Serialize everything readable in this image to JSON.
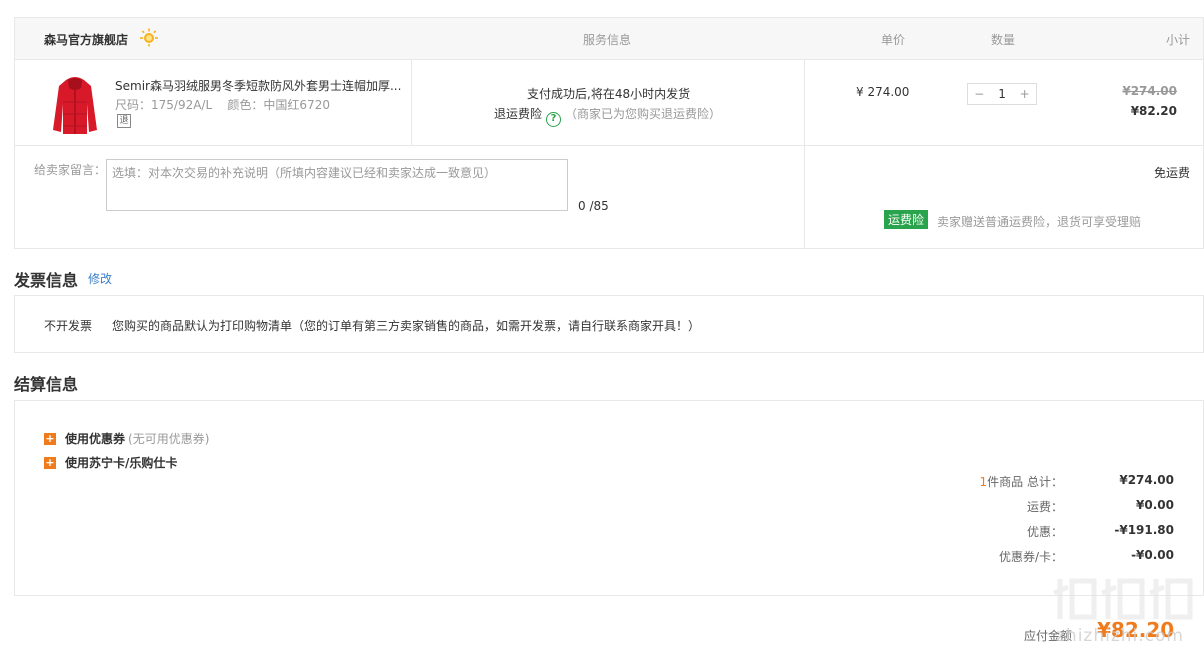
{
  "store": {
    "name": "森马官方旗舰店",
    "badge_icon": "sun-badge-icon"
  },
  "columns": {
    "service": "服务信息",
    "unit_price": "单价",
    "quantity": "数量",
    "subtotal": "小计"
  },
  "item": {
    "title": "Semir森马羽绒服男冬季短款防风外套男士连帽加厚...",
    "size": "尺码：175/92A/L",
    "color": "颜色：中国红6720",
    "refund_tag": "退",
    "shipping": "支付成功后,将在48小时内发货",
    "insurance_label": "退运费险",
    "insurance_note": "（商家已为您购买退运费险）",
    "unit_price": "¥ 274.00",
    "qty": "1",
    "qty_minus": "−",
    "qty_plus": "+",
    "original_subtotal": "¥274.00",
    "subtotal": "¥82.20"
  },
  "message": {
    "label": "给卖家留言：",
    "placeholder": "选填：对本次交易的补充说明（所填内容建议已经和卖家达成一致意见）",
    "counter": "0 /85"
  },
  "shipping": {
    "fee": "免运费",
    "insurance_badge": "运费险",
    "insurance_desc": "卖家赠送普通运费险，退货可享受理赔"
  },
  "invoice": {
    "title": "发票信息",
    "edit": "修改",
    "type": "不开发票",
    "desc": "您购买的商品默认为打印购物清单（您的订单有第三方卖家销售的商品，如需开发票，请自行联系商家开具！）"
  },
  "settlement": {
    "title": "结算信息",
    "coupon_label": "使用优惠券",
    "coupon_note": "(无可用优惠券)",
    "card_label": "使用苏宁卡/乐购仕卡",
    "count_prefix": "1",
    "total_label": "件商品 总计：",
    "total": "¥274.00",
    "freight_label": "运费：",
    "freight": "¥0.00",
    "discount_label": "优惠：",
    "discount": "-¥191.80",
    "coupon_card_label": "优惠券/卡：",
    "coupon_card": "-¥0.00",
    "payable_label": "应付金额",
    "payable": "¥82.20"
  },
  "watermark": "zhizhizhi.com",
  "colors": {
    "accent": "#f07b1d",
    "green": "#2aa44c",
    "link": "#3a7ecb"
  }
}
